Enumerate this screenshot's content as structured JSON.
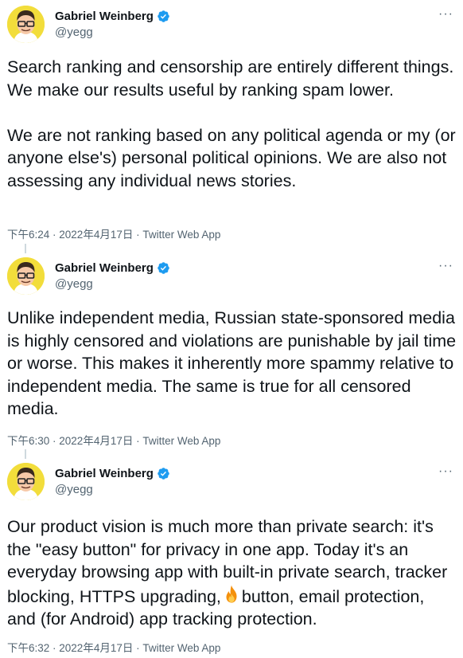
{
  "tweets": [
    {
      "author": {
        "name": "Gabriel Weinberg",
        "handle": "@yegg"
      },
      "more_label": "···",
      "text": "Search ranking and censorship are entirely different things. We make our results useful by ranking spam lower.\n\nWe are not ranking based on any political agenda or my (or anyone else's) personal political opinions. We are also not assessing any individual news stories.",
      "time": "下午6:24",
      "date": "2022年4月17日",
      "source": "Twitter Web App"
    },
    {
      "author": {
        "name": "Gabriel Weinberg",
        "handle": "@yegg"
      },
      "more_label": "···",
      "text": "Unlike independent media, Russian state-sponsored media is highly censored and violations are punishable by jail time or worse. This makes it inherently more spammy relative to independent media. The same is true for all censored media.",
      "time": "下午6:30",
      "date": "2022年4月17日",
      "source": "Twitter Web App"
    },
    {
      "author": {
        "name": "Gabriel Weinberg",
        "handle": "@yegg"
      },
      "more_label": "···",
      "text_before_emoji": "Our product vision is much more than private search: it's the \"easy button\" for privacy in one app. Today it's an everyday browsing app with built-in private search, tracker blocking, HTTPS upgrading,",
      "emoji": "fire-icon",
      "text_after_emoji": "button, email protection, and (for Android) app tracking protection.",
      "time": "下午6:32",
      "date": "2022年4月17日",
      "source": "Twitter Web App"
    }
  ],
  "separator": " · ",
  "colors": {
    "text": "#0f1419",
    "secondary": "#536471",
    "verified": "#1d9bf0",
    "avatar_bg": "#f2dd3b",
    "thread_line": "#cfd9de"
  }
}
